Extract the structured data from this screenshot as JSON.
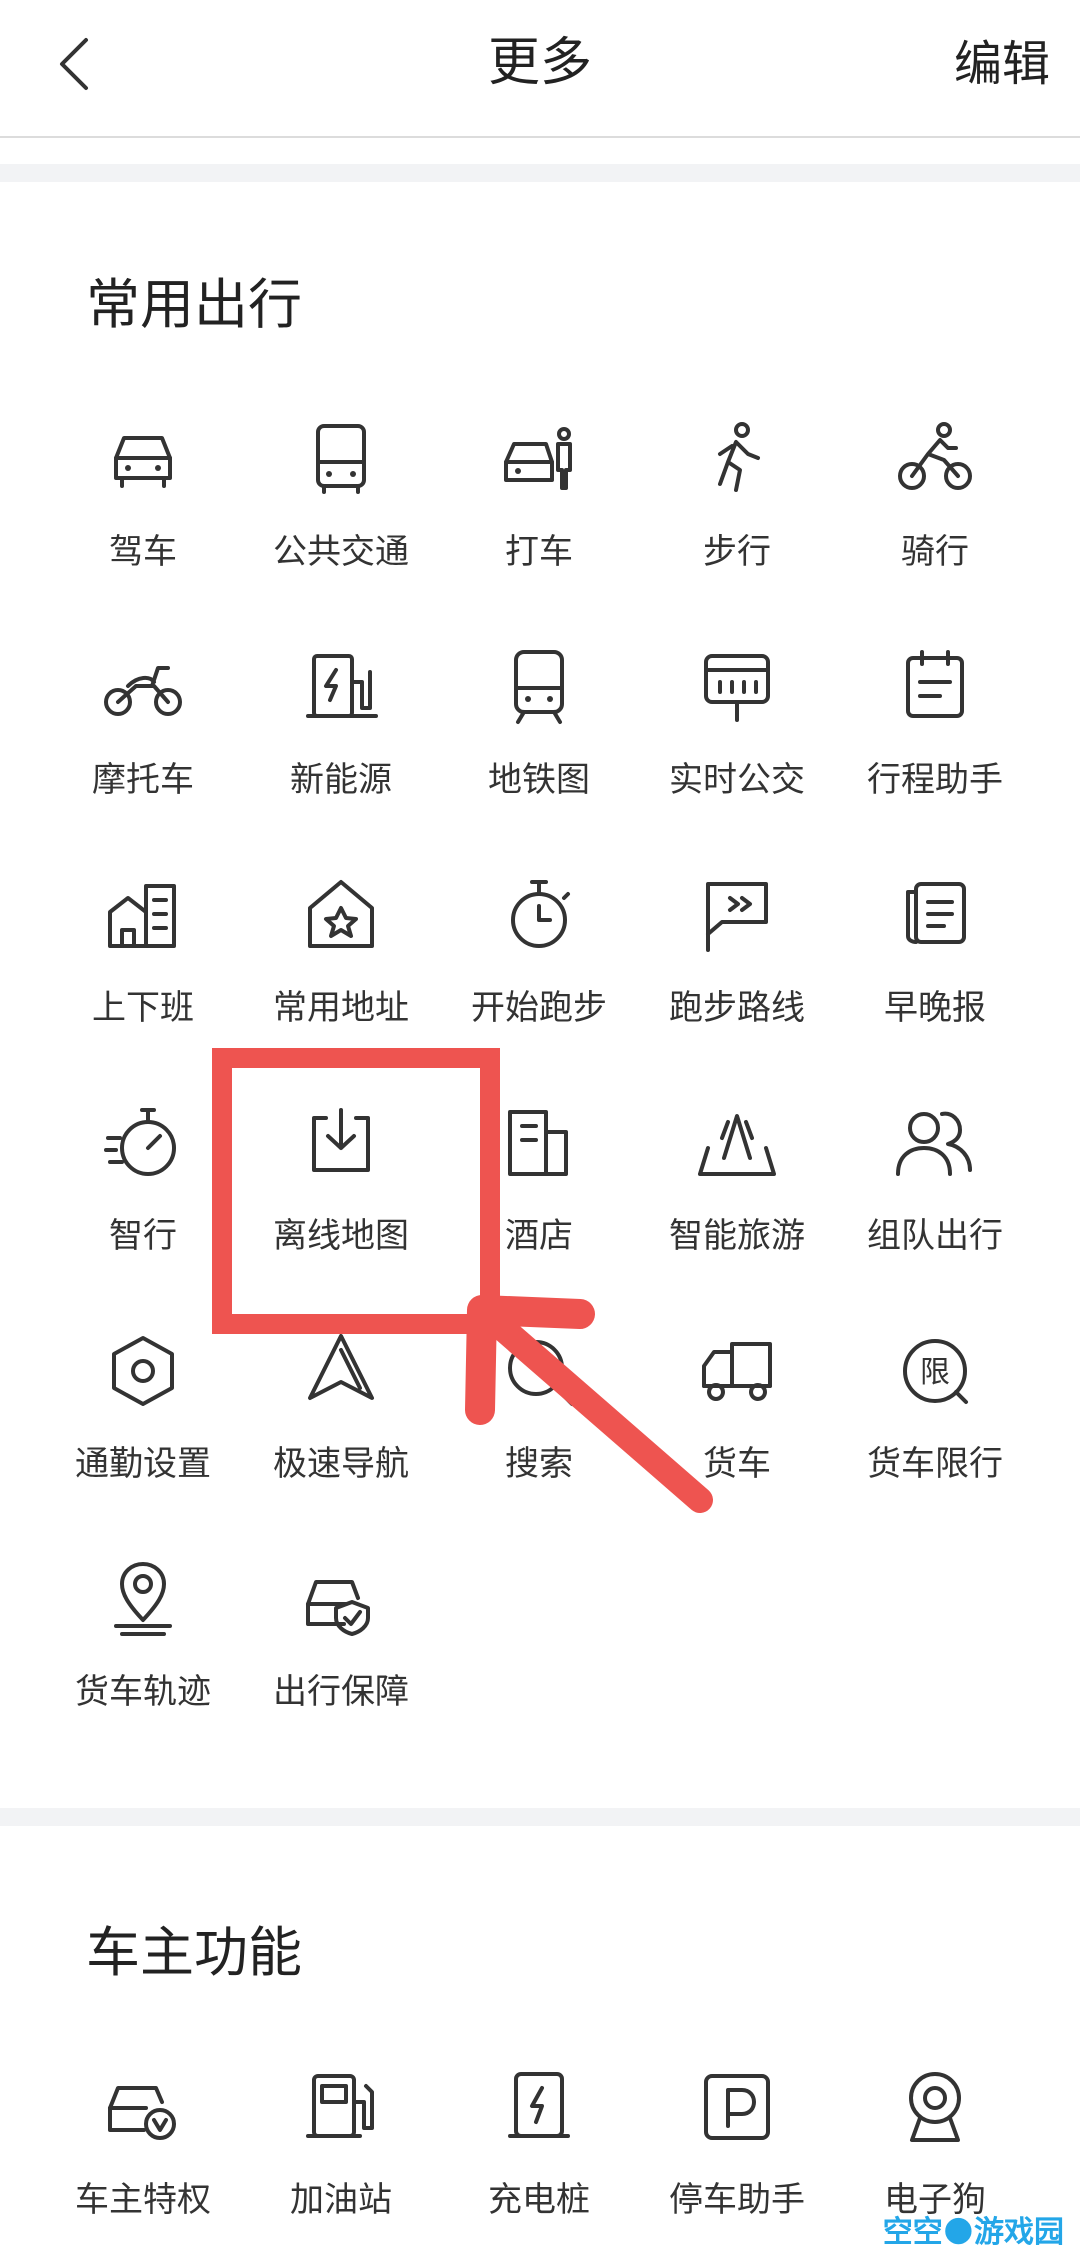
{
  "header": {
    "title": "更多",
    "edit_label": "编辑"
  },
  "section1": {
    "title": "常用出行",
    "items": [
      {
        "label": "驾车",
        "icon": "car-icon"
      },
      {
        "label": "公共交通",
        "icon": "bus-icon"
      },
      {
        "label": "打车",
        "icon": "taxi-icon"
      },
      {
        "label": "步行",
        "icon": "walk-icon"
      },
      {
        "label": "骑行",
        "icon": "bike-icon"
      },
      {
        "label": "摩托车",
        "icon": "motorcycle-icon"
      },
      {
        "label": "新能源",
        "icon": "charging-icon"
      },
      {
        "label": "地铁图",
        "icon": "subway-icon"
      },
      {
        "label": "实时公交",
        "icon": "realtime-bus-icon"
      },
      {
        "label": "行程助手",
        "icon": "calendar-icon"
      },
      {
        "label": "上下班",
        "icon": "commute-building-icon"
      },
      {
        "label": "常用地址",
        "icon": "home-star-icon"
      },
      {
        "label": "开始跑步",
        "icon": "stopwatch-icon"
      },
      {
        "label": "跑步路线",
        "icon": "route-flag-icon"
      },
      {
        "label": "早晚报",
        "icon": "newspaper-icon"
      },
      {
        "label": "智行",
        "icon": "speed-gauge-icon"
      },
      {
        "label": "离线地图",
        "icon": "download-icon"
      },
      {
        "label": "酒店",
        "icon": "hotel-icon"
      },
      {
        "label": "智能旅游",
        "icon": "travel-icon"
      },
      {
        "label": "组队出行",
        "icon": "team-icon"
      },
      {
        "label": "通勤设置",
        "icon": "settings-hexagon-icon"
      },
      {
        "label": "极速导航",
        "icon": "navigation-arrow-icon"
      },
      {
        "label": "搜索",
        "icon": "search-icon"
      },
      {
        "label": "货车",
        "icon": "truck-icon"
      },
      {
        "label": "货车限行",
        "icon": "truck-limit-icon"
      },
      {
        "label": "货车轨迹",
        "icon": "location-pin-icon"
      },
      {
        "label": "出行保障",
        "icon": "car-shield-icon"
      }
    ]
  },
  "section2": {
    "title": "车主功能",
    "items": [
      {
        "label": "车主特权",
        "icon": "car-privilege-icon"
      },
      {
        "label": "加油站",
        "icon": "gas-station-icon"
      },
      {
        "label": "充电桩",
        "icon": "charging-pile-icon"
      },
      {
        "label": "停车助手",
        "icon": "parking-icon"
      },
      {
        "label": "电子狗",
        "icon": "camera-icon"
      }
    ]
  },
  "annotation": {
    "highlight_color": "#ee5450"
  },
  "watermark": {
    "text": "空空🌑游戏园"
  }
}
